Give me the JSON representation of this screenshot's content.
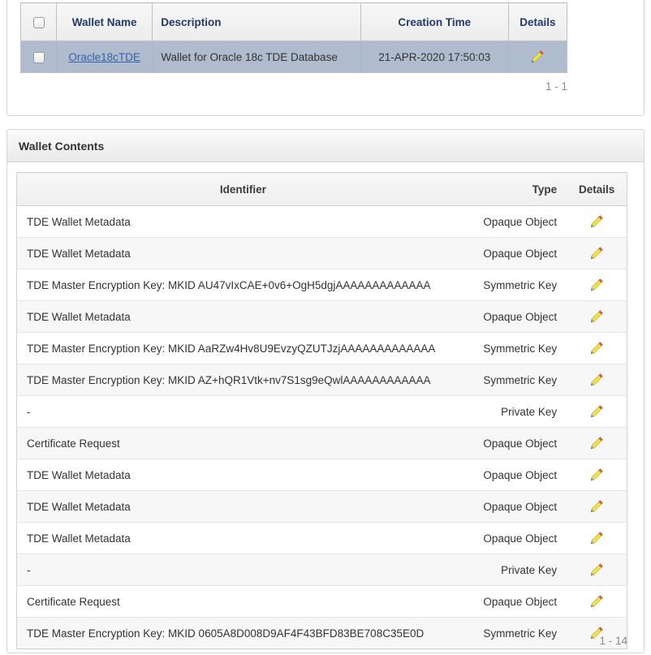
{
  "colors": {
    "header_text": "#243a6b",
    "link": "#3b5ea8",
    "selected_row": "#aebcce",
    "pencil_body": "#f2e14c",
    "pencil_eraser": "#e8543f",
    "pager_text": "#8a8a8a",
    "stripe": "#f7f7f7"
  },
  "wallet_table": {
    "columns": [
      {
        "label": "",
        "name": "select-all"
      },
      {
        "label": "Wallet Name",
        "name": "wallet-name"
      },
      {
        "label": "Description",
        "name": "description"
      },
      {
        "label": "Creation Time",
        "name": "creation-time"
      },
      {
        "label": "Details",
        "name": "details"
      }
    ],
    "rows": [
      {
        "selected": true,
        "wallet_name": "Oracle18cTDE",
        "description": "Wallet for Oracle 18c TDE Database",
        "creation_time": "21-APR-2020 17:50:03",
        "details_icon": "pencil-icon"
      }
    ],
    "pager": "1 - 1"
  },
  "contents": {
    "title": "Wallet Contents",
    "columns": [
      {
        "label": "Identifier",
        "name": "identifier"
      },
      {
        "label": "Type",
        "name": "type"
      },
      {
        "label": "Details",
        "name": "details"
      }
    ],
    "rows": [
      {
        "identifier": "TDE Wallet Metadata",
        "type": "Opaque Object",
        "details_icon": "pencil-icon"
      },
      {
        "identifier": "TDE Wallet Metadata",
        "type": "Opaque Object",
        "details_icon": "pencil-icon"
      },
      {
        "identifier": "TDE Master Encryption Key: MKID AU47vIxCAE+0v6+OgH5dgjAAAAAAAAAAAAA",
        "type": "Symmetric Key",
        "details_icon": "pencil-icon"
      },
      {
        "identifier": "TDE Wallet Metadata",
        "type": "Opaque Object",
        "details_icon": "pencil-icon"
      },
      {
        "identifier": "TDE Master Encryption Key: MKID AaRZw4Hv8U9EvzyQZUTJzjAAAAAAAAAAAAA",
        "type": "Symmetric Key",
        "details_icon": "pencil-icon"
      },
      {
        "identifier": "TDE Master Encryption Key: MKID AZ+hQR1Vtk+nv7S1sg9eQwlAAAAAAAAAAAA",
        "type": "Symmetric Key",
        "details_icon": "pencil-icon"
      },
      {
        "identifier": "-",
        "type": "Private Key",
        "details_icon": "pencil-icon"
      },
      {
        "identifier": "Certificate Request",
        "type": "Opaque Object",
        "details_icon": "pencil-icon"
      },
      {
        "identifier": "TDE Wallet Metadata",
        "type": "Opaque Object",
        "details_icon": "pencil-icon"
      },
      {
        "identifier": "TDE Wallet Metadata",
        "type": "Opaque Object",
        "details_icon": "pencil-icon"
      },
      {
        "identifier": "TDE Wallet Metadata",
        "type": "Opaque Object",
        "details_icon": "pencil-icon"
      },
      {
        "identifier": "-",
        "type": "Private Key",
        "details_icon": "pencil-icon"
      },
      {
        "identifier": "Certificate Request",
        "type": "Opaque Object",
        "details_icon": "pencil-icon"
      },
      {
        "identifier": "TDE Master Encryption Key: MKID 0605A8D008D9AF4F43BFD83BE708C35E0D",
        "type": "Symmetric Key",
        "details_icon": "pencil-icon"
      }
    ],
    "pager": "1 - 14"
  }
}
